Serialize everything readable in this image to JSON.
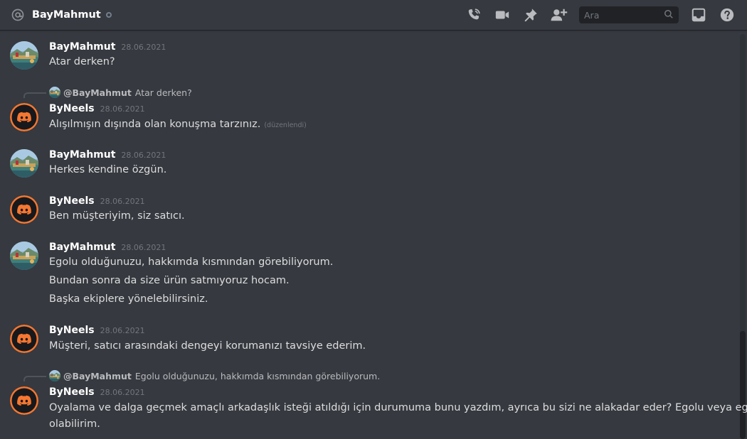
{
  "header": {
    "channel_name": "BayMahmut",
    "status": "offline",
    "search_placeholder": "Ara",
    "icons": [
      "at-icon",
      "start-voice-call-icon",
      "start-video-call-icon",
      "pinned-messages-icon",
      "add-friends-icon",
      "search-icon",
      "inbox-icon",
      "help-icon"
    ]
  },
  "colors": {
    "background": "#36393f",
    "header_text": "#ffffff",
    "timestamp": "#72767d",
    "discord_orange": "#f57731"
  },
  "messages": [
    {
      "author": "BayMahmut",
      "timestamp": "28.06.2021",
      "lines": [
        "Atar derken?"
      ]
    },
    {
      "author": "ByNeels",
      "timestamp": "28.06.2021",
      "reply": {
        "mention": "@BayMahmut",
        "text": "Atar derken?"
      },
      "lines": [
        "Alışılmışın dışında olan konuşma tarzınız."
      ],
      "edited": "(düzenlendi)"
    },
    {
      "author": "BayMahmut",
      "timestamp": "28.06.2021",
      "lines": [
        "Herkes kendine özgün."
      ]
    },
    {
      "author": "ByNeels",
      "timestamp": "28.06.2021",
      "lines": [
        "Ben müşteriyim, siz satıcı."
      ]
    },
    {
      "author": "BayMahmut",
      "timestamp": "28.06.2021",
      "lines": [
        "Egolu olduğunuzu, hakkımda kısmından görebiliyorum.",
        "Bundan sonra da size ürün satmıyoruz hocam.",
        "Başka ekiplere yönelebilirsiniz."
      ]
    },
    {
      "author": "ByNeels",
      "timestamp": "28.06.2021",
      "lines": [
        "Müşteri, satıcı arasındaki dengeyi korumanızı tavsiye ederim."
      ]
    },
    {
      "author": "ByNeels",
      "timestamp": "28.06.2021",
      "reply": {
        "mention": "@BayMahmut",
        "text": "Egolu olduğunuzu, hakkımda kısmından görebiliyorum."
      },
      "lines": [
        "Oyalama ve dalga geçmek amaçlı arkadaşlık isteği atıldığı için durumuma bunu yazdım, ayrıca bu sizi ne alakadar eder? Egolu veya egosuz",
        "olabilirim."
      ]
    }
  ]
}
